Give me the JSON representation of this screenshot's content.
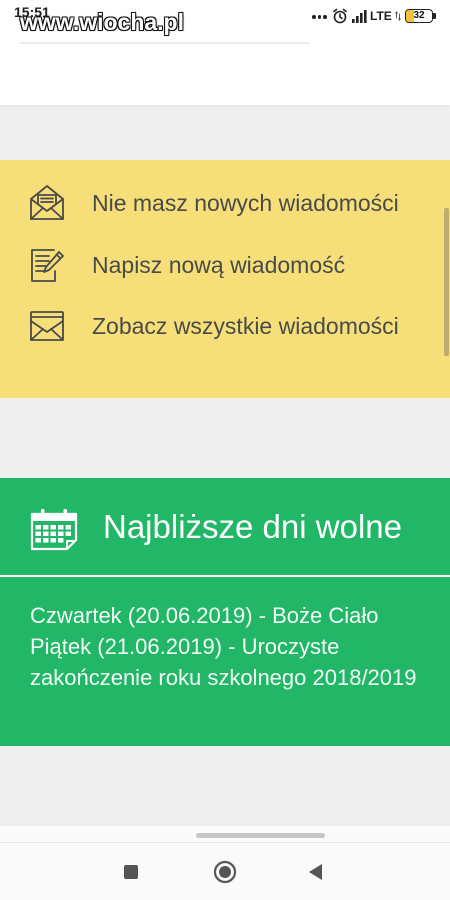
{
  "status_bar": {
    "time": "15:51",
    "watermark": "www.wiocha.pl",
    "network_type": "LTE",
    "battery_text": "32",
    "battery_level_percent": 32,
    "icons": [
      "more-notifications-icon",
      "alarm-icon",
      "signal-icon",
      "data-arrows-icon",
      "battery-icon"
    ]
  },
  "messages_panel": {
    "items": [
      {
        "label": "Nie masz nowych wiadomości",
        "icon": "envelope-open-icon"
      },
      {
        "label": "Napisz nową wiadomość",
        "icon": "compose-message-icon"
      },
      {
        "label": "Zobacz wszystkie wiadomości",
        "icon": "envelope-icon"
      }
    ]
  },
  "free_days_panel": {
    "title": "Najbliższe dni wolne",
    "icon": "calendar-icon",
    "entries": [
      {
        "lines": [
          "Czwartek (20.06.2019) - Boże Ciało"
        ]
      },
      {
        "lines": [
          "Piątek (21.06.2019) - Uroczyste",
          "zakończenie roku szkolnego 2018/2019"
        ]
      }
    ]
  },
  "nav_bar": {
    "icons": [
      "recent-apps-icon",
      "home-icon",
      "back-icon"
    ]
  },
  "colors": {
    "page_bg": "#efefef",
    "messages_panel_bg": "#f6df78",
    "messages_text": "#4a4a4a",
    "free_days_panel_bg": "#21b767",
    "nav_icon": "#555555"
  }
}
